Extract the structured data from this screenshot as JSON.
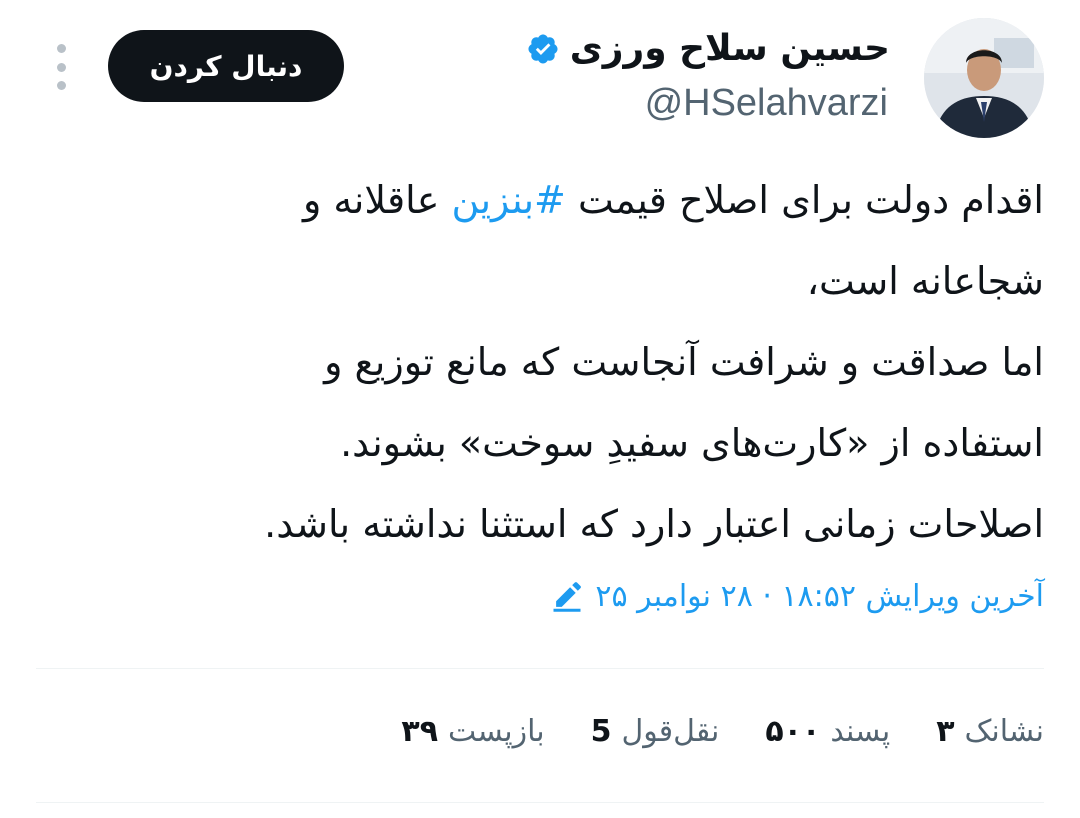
{
  "author": {
    "name": "حسین سلاح ورزی",
    "handle": "@HSelahvarzi",
    "verified_color": "#1d9bf0"
  },
  "follow_button": {
    "label": "دنبال کردن"
  },
  "more_menu": {
    "icon": "more-horizontal-icon"
  },
  "tweet": {
    "lines": [
      {
        "before": "اقدام دولت برای اصلاح قیمت ",
        "hashtag": "#بنزین",
        "after": " عاقلانه و"
      },
      {
        "text": "شجاعانه است،"
      },
      {
        "text": "اما صداقت و شرافت آنجاست که مانع توزیع و"
      },
      {
        "text": "استفاده از «کارت‌های سفیدِ سوخت» بشوند."
      },
      {
        "text": "اصلاحات زمانی اعتبار دارد که استثنا نداشته باشد."
      }
    ]
  },
  "edited": {
    "text": "آخرین ویرایش ۱۸:۵۲ · ۲۸ نوامبر ۲۵",
    "icon": "pencil-icon"
  },
  "stats": [
    {
      "num": "۳۹",
      "label": "بازپست"
    },
    {
      "num": "5",
      "label": "نقل‌قول"
    },
    {
      "num": "۵۰۰",
      "label": "پسند"
    },
    {
      "num": "۳",
      "label": "نشانک"
    }
  ],
  "colors": {
    "accent": "#1d9bf0",
    "text": "#0f1419",
    "secondary": "#536471",
    "button_bg": "#0f1419"
  }
}
